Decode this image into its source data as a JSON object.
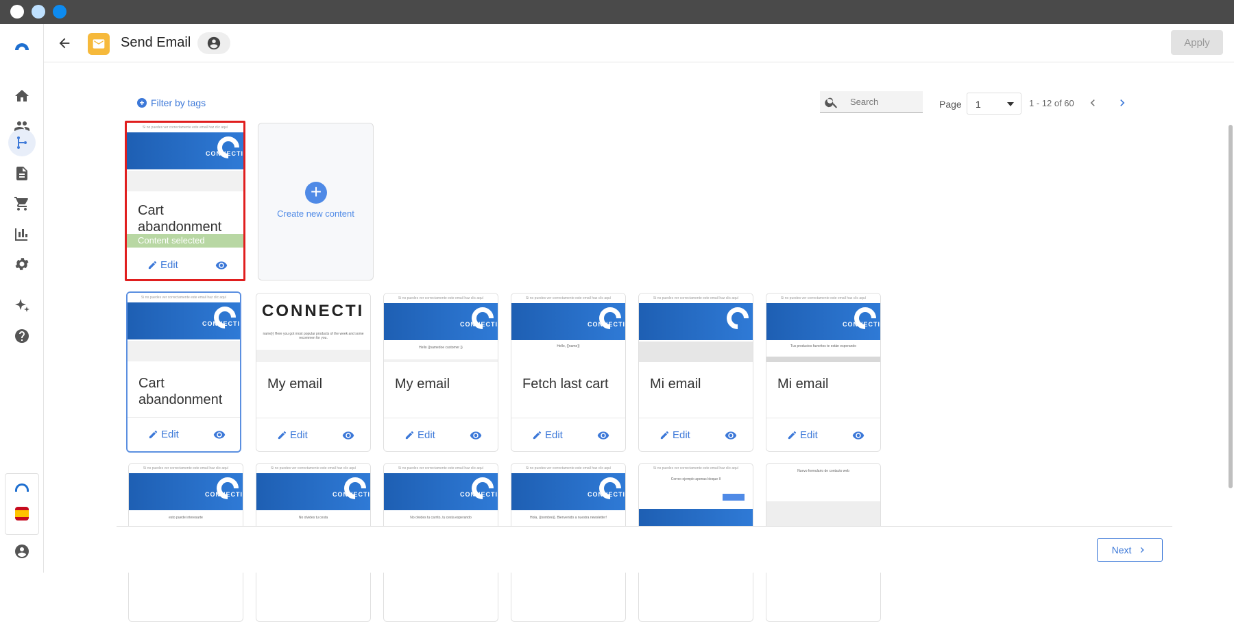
{
  "window": {
    "dots": [
      "#ffffff",
      "#bfe1ff",
      "#0d8bf0"
    ]
  },
  "header": {
    "title": "Send Email",
    "apply_label": "Apply"
  },
  "toolbar": {
    "filter_label": "Filter by tags",
    "search_placeholder": "Search",
    "page_label": "Page",
    "page_value": "1",
    "range_text": "1 - 12 of 60"
  },
  "selected_card": {
    "title": "Cart abandonment",
    "badge": "Content selected",
    "edit_label": "Edit"
  },
  "create_card": {
    "label": "Create new content"
  },
  "cards_row1": [
    {
      "title": "Cart abandonment",
      "edit_label": "Edit",
      "thumb_text": ""
    },
    {
      "title": "My email",
      "edit_label": "Edit",
      "thumb_text": "name}} Here you got most popular products of the week and some recommen for you."
    },
    {
      "title": "My email",
      "edit_label": "Edit",
      "thumb_text": "Hello {{namedoe customer }}"
    },
    {
      "title": "Fetch last cart",
      "edit_label": "Edit",
      "thumb_text": "Hello, {{name}}"
    },
    {
      "title": "Mi email",
      "edit_label": "Edit",
      "thumb_text": ""
    },
    {
      "title": "Mi email",
      "edit_label": "Edit",
      "thumb_text": "Tus productos favoritos te están esperando"
    }
  ],
  "cards_row2": [
    {
      "thumb_text": "esto puede interesarte"
    },
    {
      "thumb_text": "No olvides tu cesta"
    },
    {
      "thumb_text": "No olvides tu carrito, tu cesta esperando"
    },
    {
      "thumb_text": "Hola, {{nombre}}. Bienvenido a nuestra newsletter!"
    },
    {
      "thumb_text": "Correo ejemplo apenas bloque II"
    },
    {
      "thumb_text": "Nuevo formulario de contacto web"
    }
  ],
  "thumb_common": {
    "tiny_header": "Si no puedes ver correctamente este email haz clic aquí",
    "logo": "CONNECTI"
  },
  "footer": {
    "next_label": "Next"
  }
}
